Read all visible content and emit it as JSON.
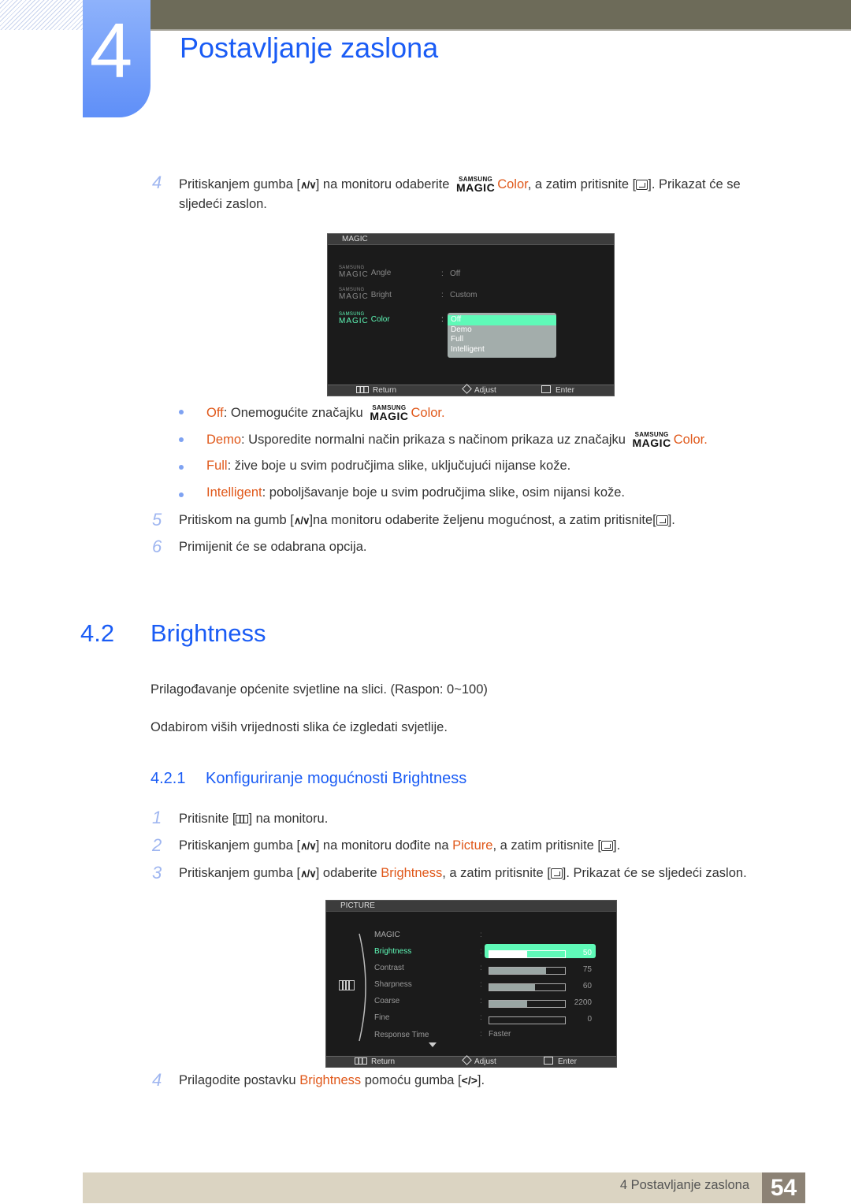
{
  "chapter": {
    "number": "4",
    "title": "Postavljanje zaslona"
  },
  "step4a": {
    "num": "4",
    "t1": "Pritiskanjem gumba [",
    "t2": "] na monitoru odaberite",
    "logo_top": "SAMSUNG",
    "logo_bottom": "MAGIC",
    "hl": "Color",
    "t3": ", a zatim pritisnite [",
    "t4": "]. Prikazat će se",
    "t5": "sljedeći zaslon."
  },
  "osd_magic": {
    "title": "MAGIC",
    "rows": [
      {
        "logo_top": "SAMSUNG",
        "logo_bottom": "MAGIC",
        "label": "Angle",
        "sep": ":",
        "value": "Off"
      },
      {
        "logo_top": "SAMSUNG",
        "logo_bottom": "MAGIC",
        "label": "Bright",
        "sep": ":",
        "value": "Custom"
      },
      {
        "logo_top": "SAMSUNG",
        "logo_bottom": "MAGIC",
        "label": "Color",
        "sep": ":",
        "value": ""
      }
    ],
    "options": [
      "Off",
      "Demo",
      "Full",
      "Intelligent"
    ],
    "selected_option": "Off",
    "footer": {
      "return": "Return",
      "adjust": "Adjust",
      "enter": "Enter"
    }
  },
  "bullets": [
    {
      "hl": "Off",
      "text": ": Onemogućite značajku",
      "logo_top": "SAMSUNG",
      "logo_bottom": "MAGIC",
      "tail": "Color."
    },
    {
      "hl": "Demo",
      "text": ": Usporedite normalni način prikaza s načinom prikaza uz značajku",
      "logo_top": "SAMSUNG",
      "logo_bottom": "MAGIC",
      "tail": "Color."
    },
    {
      "hl": "Full",
      "text": ": žive boje u svim područjima slike, uključujući nijanse kože."
    },
    {
      "hl": "Intelligent",
      "text": ": poboljšavanje boje u svim područjima slike, osim nijansi kože."
    }
  ],
  "step5": {
    "num": "5",
    "t1": "Pritiskom na gumb [",
    "t2": "]na monitoru odaberite željenu mogućnost, a zatim pritisnite[",
    "t3": "]."
  },
  "step6": {
    "num": "6",
    "text": "Primijenit će se odabrana opcija."
  },
  "section": {
    "number": "4.2",
    "title": "Brightness",
    "p1": "Prilagođavanje općenite svjetline na slici. (Raspon: 0~100)",
    "p2": "Odabirom viših vrijednosti slika će izgledati svjetlije."
  },
  "subsection": {
    "number": "4.2.1",
    "title": "Konfiguriranje mogućnosti Brightness"
  },
  "steps_b": [
    {
      "num": "1",
      "t1": "Pritisnite [",
      "t2": "] na monitoru."
    },
    {
      "num": "2",
      "t1": "Pritiskanjem gumba [",
      "t2": "] na monitoru dođite na ",
      "hl": "Picture",
      "t3": ", a zatim pritisnite [",
      "t4": "]."
    },
    {
      "num": "3",
      "t1": "Pritiskanjem gumba [",
      "t2": "] odaberite ",
      "hl": "Brightness",
      "t3": ", a zatim pritisnite [",
      "t4": "]. Prikazat će se sljedeći zaslon."
    },
    {
      "num": "4",
      "t1": "Prilagodite postavku ",
      "hl": "Brightness",
      "t2": " pomoću gumba [",
      "icon": "</>",
      "t3": "]."
    }
  ],
  "osd_picture": {
    "title": "PICTURE",
    "rows": [
      {
        "label": "MAGIC",
        "value": "",
        "level": null
      },
      {
        "label": "Brightness",
        "value": "50",
        "level": 0.5
      },
      {
        "label": "Contrast",
        "value": "75",
        "level": 0.75
      },
      {
        "label": "Sharpness",
        "value": "60",
        "level": 0.6
      },
      {
        "label": "Coarse",
        "value": "2200",
        "level": 0.5
      },
      {
        "label": "Fine",
        "value": "0",
        "level": 0
      },
      {
        "label": "Response Time",
        "value": "Faster",
        "level": null
      }
    ],
    "selected": "Brightness",
    "footer": {
      "return": "Return",
      "adjust": "Adjust",
      "enter": "Enter"
    }
  },
  "footer": {
    "text": "4 Postavljanje zaslona",
    "page": "54"
  },
  "colors": {
    "accent_blue": "#1a5cf5",
    "highlight_orange": "#e0581a",
    "osd_select": "#5ffab8"
  }
}
